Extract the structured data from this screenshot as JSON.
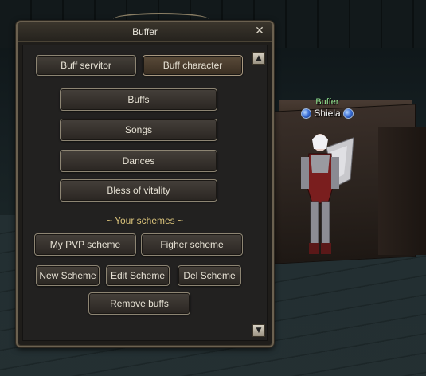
{
  "window": {
    "title": "Buffer",
    "close_glyph": "✕"
  },
  "tabs": [
    {
      "label": "Buff servitor"
    },
    {
      "label": "Buff character"
    }
  ],
  "menu": [
    {
      "label": "Buffs"
    },
    {
      "label": "Songs"
    },
    {
      "label": "Dances"
    },
    {
      "label": "Bless of vitality"
    }
  ],
  "schemes": {
    "heading": "~ Your schemes ~",
    "items": [
      {
        "label": "My PVP scheme"
      },
      {
        "label": "Figher scheme"
      }
    ]
  },
  "actions": [
    {
      "label": "New Scheme"
    },
    {
      "label": "Edit Scheme"
    },
    {
      "label": "Del Scheme"
    }
  ],
  "remove_label": "Remove buffs",
  "scroll": {
    "up_glyph": "▲",
    "down_glyph": "▼"
  },
  "npc": {
    "title": "Buffer",
    "name": "Shiela"
  },
  "colors": {
    "npc_title": "#8fe28f",
    "section_title": "#d9c27a",
    "button_border": "#8d8573"
  }
}
